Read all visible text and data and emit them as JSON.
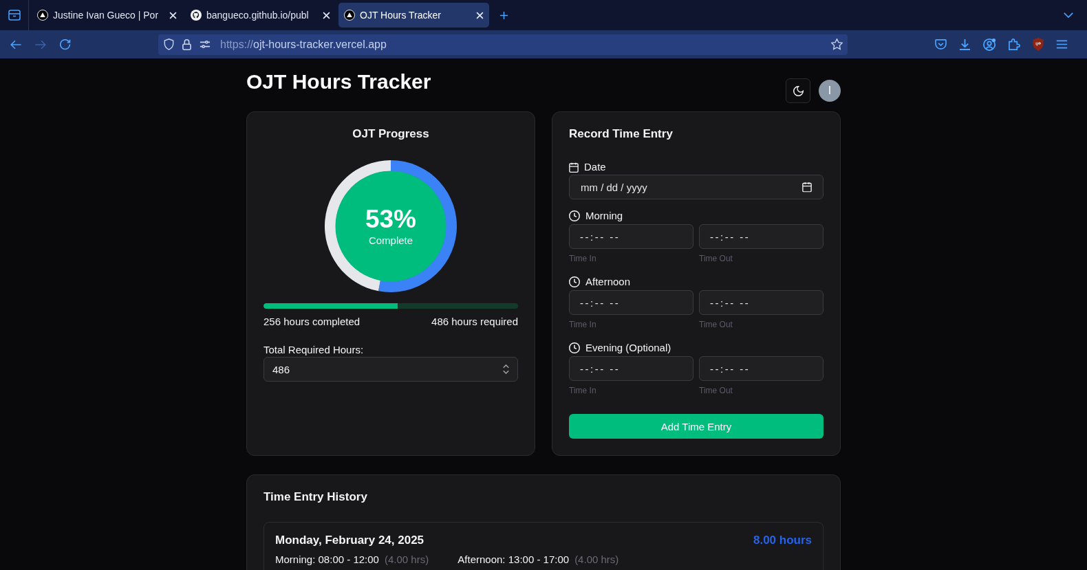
{
  "browser": {
    "tabs": [
      {
        "kind": "vercel",
        "title": "Justine Ivan Gueco | Por",
        "selected": false
      },
      {
        "kind": "github",
        "title": "bangueco.github.io/publ",
        "selected": false
      },
      {
        "kind": "vercel",
        "title": "OJT Hours Tracker",
        "selected": true
      }
    ],
    "address": {
      "scheme": "https://",
      "host": "ojt-hours-tracker.vercel.app"
    }
  },
  "header": {
    "title": "OJT Hours Tracker",
    "avatar_initial": "I"
  },
  "progress": {
    "title": "OJT Progress",
    "ring": {
      "percent": "53%",
      "caption": "Complete",
      "chart_data": {
        "type": "donut",
        "values": [
          53,
          47
        ]
      }
    },
    "bar": {
      "level": 0.527
    },
    "completed": "256 hours completed",
    "required": "486 hours required",
    "total_label": "Total Required Hours:",
    "total_value": "486"
  },
  "entry_form": {
    "title": "Record Time Entry",
    "date": {
      "label": "Date",
      "placeholder": "mm / dd / yyyy"
    },
    "sessions": [
      {
        "label": "Morning",
        "fields": [
          {
            "placeholder": "--:-- --",
            "hint": "Time In"
          },
          {
            "placeholder": "--:-- --",
            "hint": "Time Out"
          }
        ]
      },
      {
        "label": "Afternoon",
        "fields": [
          {
            "placeholder": "--:-- --",
            "hint": "Time In"
          },
          {
            "placeholder": "--:-- --",
            "hint": "Time Out"
          }
        ]
      },
      {
        "label": "Evening (Optional)",
        "fields": [
          {
            "placeholder": "--:-- --",
            "hint": "Time In"
          },
          {
            "placeholder": "--:-- --",
            "hint": "Time Out"
          }
        ]
      }
    ],
    "submit": "Add Time Entry"
  },
  "history": {
    "title": "Time Entry History",
    "entries": [
      {
        "date": "Monday, February 24, 2025",
        "total": "8.00 hours",
        "sessions": [
          {
            "time": "Morning: 08:00 - 12:00",
            "hours": "(4.00 hrs)"
          },
          {
            "time": "Afternoon: 13:00 - 17:00",
            "hours": "(4.00 hrs)"
          }
        ]
      }
    ]
  }
}
